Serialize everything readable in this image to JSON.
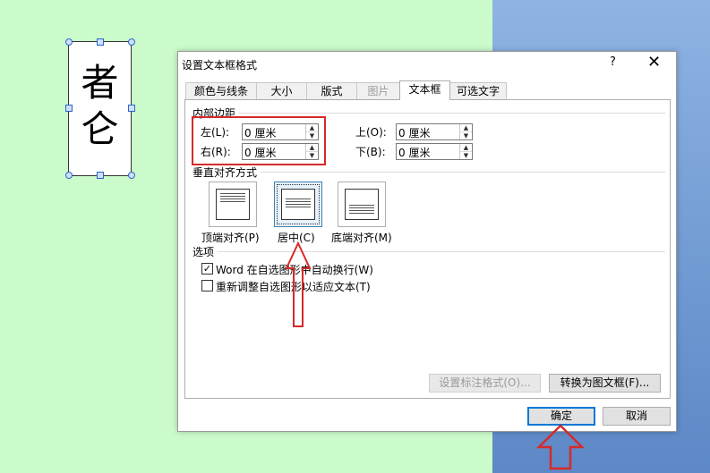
{
  "canvas": {
    "textbox_chars": "者\n仑"
  },
  "dialog": {
    "title": "设置文本框格式",
    "help_label": "?",
    "close_label": "✕",
    "tabs": [
      {
        "label": "颜色与线条"
      },
      {
        "label": "大小"
      },
      {
        "label": "版式"
      },
      {
        "label": "图片"
      },
      {
        "label": "文本框"
      },
      {
        "label": "可选文字"
      }
    ],
    "inner_margin": {
      "title": "内部边距",
      "left_label": "左(L):",
      "left_value": "0 厘米",
      "right_label": "右(R):",
      "right_value": "0 厘米",
      "top_label": "上(O):",
      "top_value": "0 厘米",
      "bottom_label": "下(B):",
      "bottom_value": "0 厘米"
    },
    "vertical_align": {
      "title": "垂直对齐方式",
      "top_label": "顶端对齐(P)",
      "center_label": "居中(C)",
      "bottom_label": "底端对齐(M)"
    },
    "options": {
      "title": "选项",
      "wrap_label": "Word 在自选图形中自动换行(W)",
      "wrap_checked": "✓",
      "resize_label": "重新调整自选图形以适应文本(T)"
    },
    "buttons": {
      "callout_format": "设置标注格式(O)...",
      "convert_frame": "转换为图文框(F)...",
      "ok": "确定",
      "cancel": "取消"
    }
  },
  "colors": {
    "annotation_red": "#d52a2a",
    "canvas_green": "#cbfbcb",
    "desktop_blue": "#6f99d2"
  }
}
